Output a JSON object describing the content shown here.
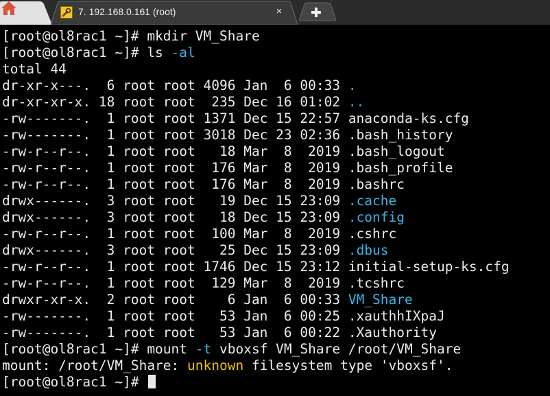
{
  "tabs": {
    "home_icon": "home-icon",
    "session": {
      "icon": "wrench-icon",
      "title": "7. 192.168.0.161 (root)",
      "close_glyph": "×"
    },
    "new_tab_icon": "plus-icon"
  },
  "colors": {
    "background": "#000000",
    "text": "#ececec",
    "directory": "#3ab4e8",
    "warning": "#f0c000",
    "home_icon": "#d9533d"
  },
  "terminal": {
    "lines": [
      {
        "text": "[root@ol8rac1 ~]# mkdir VM_Share"
      },
      {
        "pre": "[root@ol8rac1 ~]# ls ",
        "highlight": "-al"
      },
      {
        "text": "total 44"
      },
      {
        "pre": "dr-xr-x---.  6 root root 4096 Jan  6 00:33 ",
        "highlight": "."
      },
      {
        "pre": "dr-xr-xr-x. 18 root root  235 Dec 16 01:02 ",
        "highlight": ".."
      },
      {
        "text": "-rw-------.  1 root root 1371 Dec 15 22:57 anaconda-ks.cfg"
      },
      {
        "text": "-rw-------.  1 root root 3018 Dec 23 02:36 .bash_history"
      },
      {
        "text": "-rw-r--r--.  1 root root   18 Mar  8  2019 .bash_logout"
      },
      {
        "text": "-rw-r--r--.  1 root root  176 Mar  8  2019 .bash_profile"
      },
      {
        "text": "-rw-r--r--.  1 root root  176 Mar  8  2019 .bashrc"
      },
      {
        "pre": "drwx------.  3 root root   19 Dec 15 23:09 ",
        "highlight": ".cache"
      },
      {
        "pre": "drwx------.  3 root root   18 Dec 15 23:09 ",
        "highlight": ".config"
      },
      {
        "text": "-rw-r--r--.  1 root root  100 Mar  8  2019 .cshrc"
      },
      {
        "pre": "drwx------.  3 root root   25 Dec 15 23:09 ",
        "highlight": ".dbus"
      },
      {
        "text": "-rw-r--r--.  1 root root 1746 Dec 15 23:12 initial-setup-ks.cfg"
      },
      {
        "text": "-rw-r--r--.  1 root root  129 Mar  8  2019 .tcshrc"
      },
      {
        "pre": "drwxr-xr-x.  2 root root    6 Jan  6 00:33 ",
        "highlight": "VM_Share"
      },
      {
        "text": "-rw-------.  1 root root   53 Jan  6 00:25 .xauthhIXpaJ"
      },
      {
        "text": "-rw-------.  1 root root   53 Jan  6 00:22 .Xauthority"
      },
      {
        "pre": "[root@ol8rac1 ~]# mount ",
        "highlight": "-t",
        "post": " vboxsf VM_Share /root/VM_Share"
      },
      {
        "pre": "mount: /root/VM_Share: ",
        "warn": "unknown",
        "post": " filesystem type 'vboxsf'."
      },
      {
        "text": "[root@ol8rac1 ~]# "
      }
    ]
  }
}
